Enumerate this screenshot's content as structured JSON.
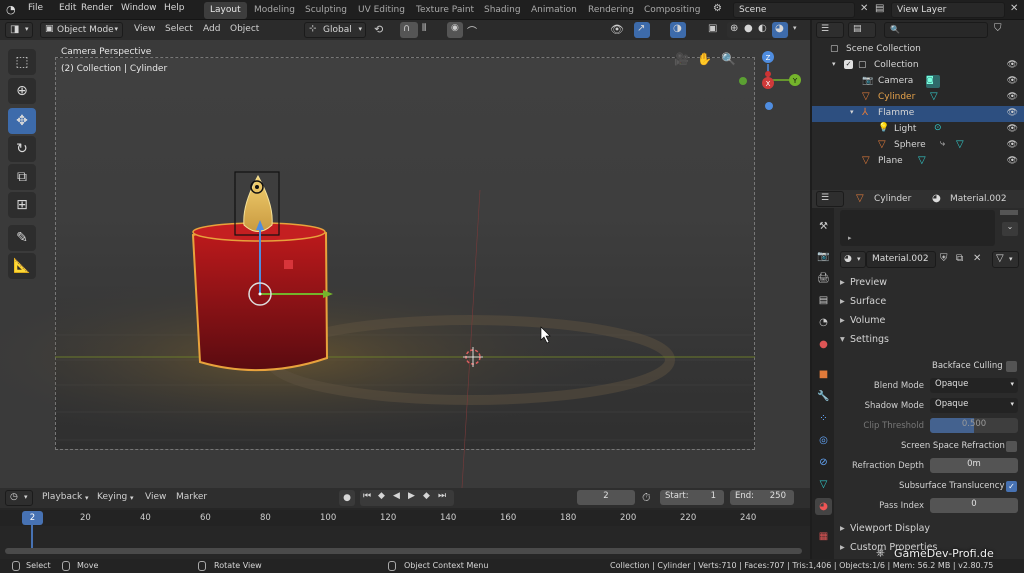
{
  "topbar": {
    "menus": [
      "File",
      "Edit",
      "Render",
      "Window",
      "Help"
    ],
    "workspaces": [
      "Layout",
      "Modeling",
      "Sculpting",
      "UV Editing",
      "Texture Paint",
      "Shading",
      "Animation",
      "Rendering",
      "Compositing"
    ],
    "active_workspace": "Layout",
    "scene": "Scene",
    "view_layer": "View Layer"
  },
  "viewport_header": {
    "mode": "Object Mode",
    "menus": [
      "View",
      "Select",
      "Add",
      "Object"
    ],
    "orientation": "Global"
  },
  "viewport": {
    "title": "Camera Perspective",
    "subtitle": "(2) Collection | Cylinder",
    "gizmo_axes": {
      "x": "X",
      "y": "Y",
      "z": "Z"
    }
  },
  "outliner": {
    "search_placeholder": "",
    "rows": [
      {
        "label": "Scene Collection",
        "depth": 0,
        "selected": false
      },
      {
        "label": "Collection",
        "depth": 1,
        "selected": false
      },
      {
        "label": "Camera",
        "depth": 2,
        "selected": false
      },
      {
        "label": "Cylinder",
        "depth": 2,
        "selected": false
      },
      {
        "label": "Flamme",
        "depth": 2,
        "selected": true
      },
      {
        "label": "Light",
        "depth": 3,
        "selected": false
      },
      {
        "label": "Sphere",
        "depth": 3,
        "selected": false
      },
      {
        "label": "Plane",
        "depth": 2,
        "selected": false
      }
    ]
  },
  "properties": {
    "object_name": "Cylinder",
    "material_name": "Material.002",
    "slot_material": "Material.002",
    "sections": [
      "Preview",
      "Surface",
      "Volume",
      "Settings"
    ],
    "settings": {
      "backface_culling": "Backface Culling",
      "blend_mode_label": "Blend Mode",
      "blend_mode": "Opaque",
      "shadow_mode_label": "Shadow Mode",
      "shadow_mode": "Opaque",
      "clip_threshold_label": "Clip Threshold",
      "clip_threshold": "0.500",
      "screen_space_refraction": "Screen Space Refraction",
      "refraction_depth_label": "Refraction Depth",
      "refraction_depth": "0m",
      "subsurface_translucency": "Subsurface Translucency",
      "pass_index_label": "Pass Index",
      "pass_index": "0"
    },
    "bottom_sections": [
      "Viewport Display",
      "Custom Properties"
    ]
  },
  "timeline": {
    "menus": [
      "Playback",
      "Keying",
      "View",
      "Marker"
    ],
    "current_frame": "2",
    "start_label": "Start:",
    "start": "1",
    "end_label": "End:",
    "end": "250",
    "ticks": [
      "20",
      "40",
      "60",
      "80",
      "100",
      "120",
      "140",
      "160",
      "180",
      "200",
      "220",
      "240"
    ]
  },
  "statusbar": {
    "select": "Select",
    "move": "Move",
    "rotate": "Rotate View",
    "context": "Object Context Menu",
    "stats": "Collection | Cylinder | Verts:710 | Faces:707 | Tris:1,406 | Objects:1/6 | Mem: 56.2 MB | v2.80.75"
  },
  "watermark": "GameDev-Profi.de",
  "colors": {
    "accent": "#4772b3",
    "selected_row": "#2d4f80",
    "candle": "#b0141a",
    "flame": "#e8b850"
  }
}
